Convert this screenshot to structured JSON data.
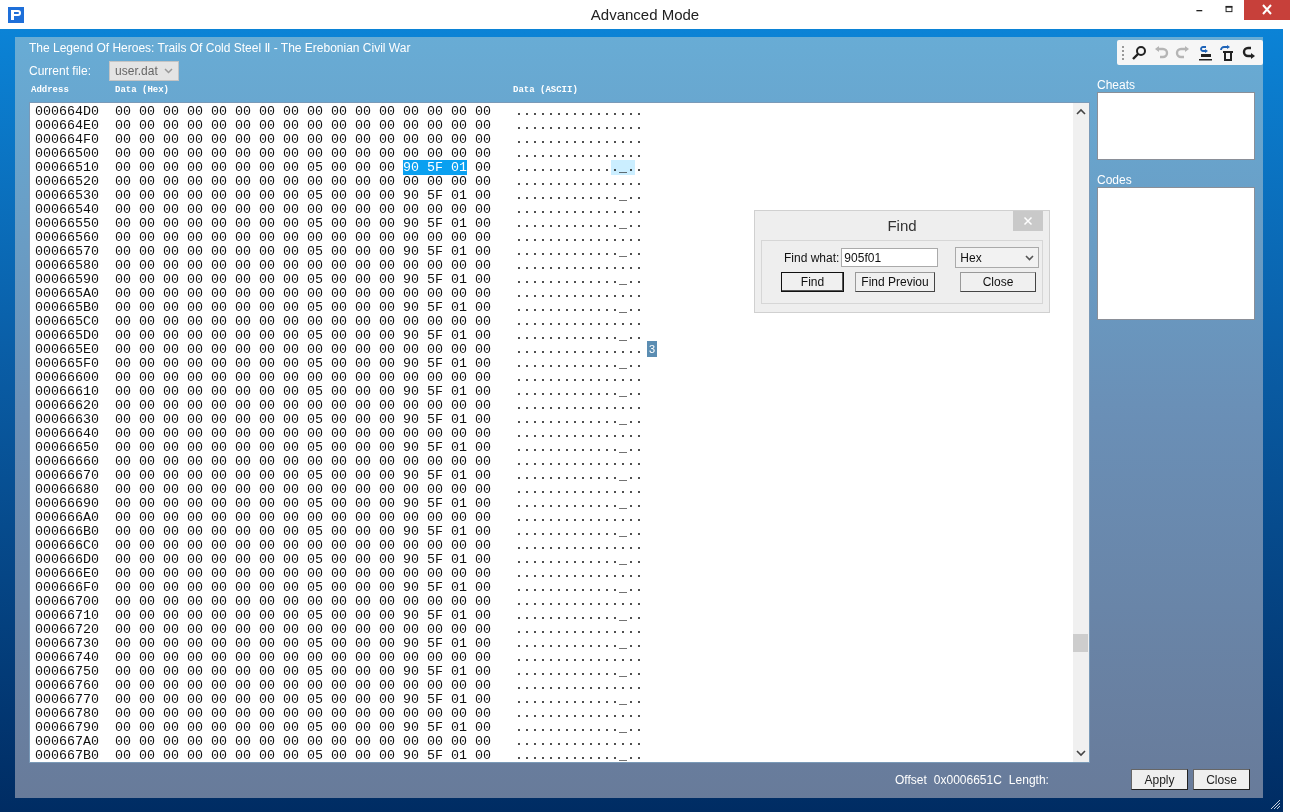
{
  "window": {
    "title": "Advanced Mode"
  },
  "game_title": "The Legend Of Heroes: Trails Of Cold Steel Ⅱ - The Erebonian Civil War",
  "current_file": {
    "label": "Current file:",
    "value": "user.dat",
    "disabled": true
  },
  "columns": [
    "Address",
    "Data (Hex)",
    "Data (ASCII)"
  ],
  "rows": [
    {
      "address": "000664D0",
      "hex": "00 00 00 00 00 00 00 00 00 00 00 00 00 00 00 00",
      "ascii": "................"
    },
    {
      "address": "000664E0",
      "hex": "00 00 00 00 00 00 00 00 00 00 00 00 00 00 00 00",
      "ascii": "................"
    },
    {
      "address": "000664F0",
      "hex": "00 00 00 00 00 00 00 00 00 00 00 00 00 00 00 00",
      "ascii": "................"
    },
    {
      "address": "00066500",
      "hex": "00 00 00 00 00 00 00 00 00 00 00 00 00 00 00 00",
      "ascii": "................"
    },
    {
      "address": "00066510",
      "hex_parts": [
        {
          "text": "00 00 00 00 00 00 00 00 05 00 00 00 ",
          "selected": false
        },
        {
          "text": "90 5F 01",
          "selected": true
        },
        {
          "text": " 00",
          "selected": false
        }
      ],
      "ascii_parts": [
        {
          "text": "............",
          "selected": false
        },
        {
          "text": "._.",
          "selected": true
        },
        {
          "text": ".",
          "selected": false
        }
      ]
    },
    {
      "address": "00066520",
      "hex": "00 00 00 00 00 00 00 00 00 00 00 00 00 00 00 00",
      "ascii": "................"
    },
    {
      "address": "00066530",
      "hex": "00 00 00 00 00 00 00 00 05 00 00 00 90 5F 01 00",
      "ascii": "............._.."
    },
    {
      "address": "00066540",
      "hex": "00 00 00 00 00 00 00 00 00 00 00 00 00 00 00 00",
      "ascii": "................"
    },
    {
      "address": "00066550",
      "hex": "00 00 00 00 00 00 00 00 05 00 00 00 90 5F 01 00",
      "ascii": "............._.."
    },
    {
      "address": "00066560",
      "hex": "00 00 00 00 00 00 00 00 00 00 00 00 00 00 00 00",
      "ascii": "................"
    },
    {
      "address": "00066570",
      "hex": "00 00 00 00 00 00 00 00 05 00 00 00 90 5F 01 00",
      "ascii": "............._.."
    },
    {
      "address": "00066580",
      "hex": "00 00 00 00 00 00 00 00 00 00 00 00 00 00 00 00",
      "ascii": "................"
    },
    {
      "address": "00066590",
      "hex": "00 00 00 00 00 00 00 00 05 00 00 00 90 5F 01 00",
      "ascii": "............._.."
    },
    {
      "address": "000665A0",
      "hex": "00 00 00 00 00 00 00 00 00 00 00 00 00 00 00 00",
      "ascii": "................"
    },
    {
      "address": "000665B0",
      "hex": "00 00 00 00 00 00 00 00 05 00 00 00 90 5F 01 00",
      "ascii": "............._.."
    },
    {
      "address": "000665C0",
      "hex": "00 00 00 00 00 00 00 00 00 00 00 00 00 00 00 00",
      "ascii": "................"
    },
    {
      "address": "000665D0",
      "hex": "00 00 00 00 00 00 00 00 05 00 00 00 90 5F 01 00",
      "ascii": "............._.."
    },
    {
      "address": "000665E0",
      "hex": "00 00 00 00 00 00 00 00 00 00 00 00 00 00 00 00",
      "ascii": "................"
    },
    {
      "address": "000665F0",
      "hex": "00 00 00 00 00 00 00 00 05 00 00 00 90 5F 01 00",
      "ascii": "............._.."
    },
    {
      "address": "00066600",
      "hex": "00 00 00 00 00 00 00 00 00 00 00 00 00 00 00 00",
      "ascii": "................"
    },
    {
      "address": "00066610",
      "hex": "00 00 00 00 00 00 00 00 05 00 00 00 90 5F 01 00",
      "ascii": "............._.."
    },
    {
      "address": "00066620",
      "hex": "00 00 00 00 00 00 00 00 00 00 00 00 00 00 00 00",
      "ascii": "................"
    },
    {
      "address": "00066630",
      "hex": "00 00 00 00 00 00 00 00 05 00 00 00 90 5F 01 00",
      "ascii": "............._.."
    },
    {
      "address": "00066640",
      "hex": "00 00 00 00 00 00 00 00 00 00 00 00 00 00 00 00",
      "ascii": "................"
    },
    {
      "address": "00066650",
      "hex": "00 00 00 00 00 00 00 00 05 00 00 00 90 5F 01 00",
      "ascii": "............._.."
    },
    {
      "address": "00066660",
      "hex": "00 00 00 00 00 00 00 00 00 00 00 00 00 00 00 00",
      "ascii": "................"
    },
    {
      "address": "00066670",
      "hex": "00 00 00 00 00 00 00 00 05 00 00 00 90 5F 01 00",
      "ascii": "............._.."
    },
    {
      "address": "00066680",
      "hex": "00 00 00 00 00 00 00 00 00 00 00 00 00 00 00 00",
      "ascii": "................"
    },
    {
      "address": "00066690",
      "hex": "00 00 00 00 00 00 00 00 05 00 00 00 90 5F 01 00",
      "ascii": "............._.."
    },
    {
      "address": "000666A0",
      "hex": "00 00 00 00 00 00 00 00 00 00 00 00 00 00 00 00",
      "ascii": "................"
    },
    {
      "address": "000666B0",
      "hex": "00 00 00 00 00 00 00 00 05 00 00 00 90 5F 01 00",
      "ascii": "............._.."
    },
    {
      "address": "000666C0",
      "hex": "00 00 00 00 00 00 00 00 00 00 00 00 00 00 00 00",
      "ascii": "................"
    },
    {
      "address": "000666D0",
      "hex": "00 00 00 00 00 00 00 00 05 00 00 00 90 5F 01 00",
      "ascii": "............._.."
    },
    {
      "address": "000666E0",
      "hex": "00 00 00 00 00 00 00 00 00 00 00 00 00 00 00 00",
      "ascii": "................"
    },
    {
      "address": "000666F0",
      "hex": "00 00 00 00 00 00 00 00 05 00 00 00 90 5F 01 00",
      "ascii": "............._.."
    },
    {
      "address": "00066700",
      "hex": "00 00 00 00 00 00 00 00 00 00 00 00 00 00 00 00",
      "ascii": "................"
    },
    {
      "address": "00066710",
      "hex": "00 00 00 00 00 00 00 00 05 00 00 00 90 5F 01 00",
      "ascii": "............._.."
    },
    {
      "address": "00066720",
      "hex": "00 00 00 00 00 00 00 00 00 00 00 00 00 00 00 00",
      "ascii": "................"
    },
    {
      "address": "00066730",
      "hex": "00 00 00 00 00 00 00 00 05 00 00 00 90 5F 01 00",
      "ascii": "............._.."
    },
    {
      "address": "00066740",
      "hex": "00 00 00 00 00 00 00 00 00 00 00 00 00 00 00 00",
      "ascii": "................"
    },
    {
      "address": "00066750",
      "hex": "00 00 00 00 00 00 00 00 05 00 00 00 90 5F 01 00",
      "ascii": "............._.."
    },
    {
      "address": "00066760",
      "hex": "00 00 00 00 00 00 00 00 00 00 00 00 00 00 00 00",
      "ascii": "................"
    },
    {
      "address": "00066770",
      "hex": "00 00 00 00 00 00 00 00 05 00 00 00 90 5F 01 00",
      "ascii": "............._.."
    },
    {
      "address": "00066780",
      "hex": "00 00 00 00 00 00 00 00 00 00 00 00 00 00 00 00",
      "ascii": "................"
    },
    {
      "address": "00066790",
      "hex": "00 00 00 00 00 00 00 00 05 00 00 00 90 5F 01 00",
      "ascii": "............._.."
    },
    {
      "address": "000667A0",
      "hex": "00 00 00 00 00 00 00 00 00 00 00 00 00 00 00 00",
      "ascii": "................"
    },
    {
      "address": "000667B0",
      "hex": "00 00 00 00 00 00 00 00 05 00 00 00 90 5F 01 00",
      "ascii": "............._.."
    }
  ],
  "hover_marker": "3",
  "toolbar": [
    {
      "kind": "search",
      "disabled": false
    },
    {
      "kind": "undo",
      "disabled": true
    },
    {
      "kind": "redo",
      "disabled": true
    },
    {
      "kind": "import",
      "disabled": false
    },
    {
      "kind": "export",
      "disabled": false
    },
    {
      "kind": "revert",
      "disabled": false
    }
  ],
  "cheats": {
    "label": "Cheats"
  },
  "codes": {
    "label": "Codes"
  },
  "status": {
    "offset_label": "Offset",
    "offset": "0x0006651C",
    "length_label": "Length:"
  },
  "buttons": [
    "Apply",
    "Close"
  ],
  "find_dialog": {
    "title": "Find",
    "find_what_label": "Find what:",
    "find_what": "905f01",
    "mode": "Hex",
    "buttons": [
      {
        "label": "Find",
        "default": true
      },
      {
        "label": "Find Previou",
        "default": false
      },
      {
        "label": "Close",
        "default": false
      }
    ]
  }
}
